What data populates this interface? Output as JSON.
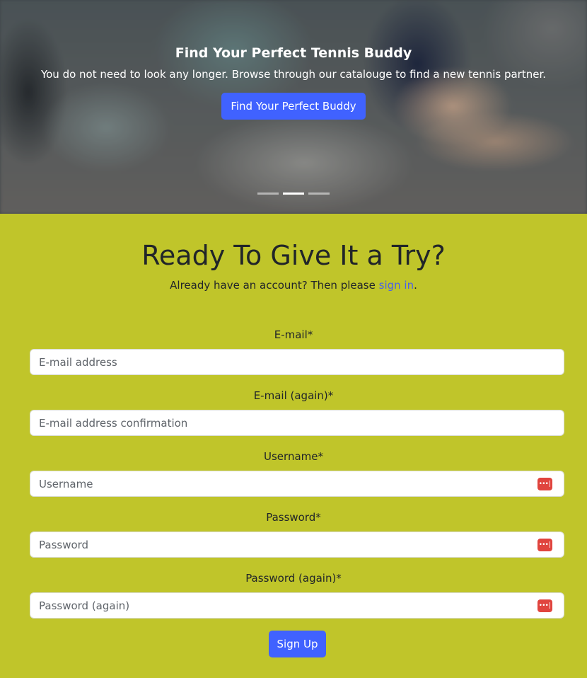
{
  "hero": {
    "title": "Find Your Perfect Tennis Buddy",
    "text": "You do not need to look any longer. Browse through our catalouge to find a new tennis partner.",
    "button_label": "Find Your Perfect Buddy",
    "active_slide": 2,
    "slide_count": 3
  },
  "signup": {
    "title": "Ready To Give It a Try?",
    "subtitle_prefix": "Already have an account? Then please ",
    "signin_link": "sign in",
    "subtitle_suffix": ".",
    "fields": [
      {
        "label": "E-mail*",
        "placeholder": "E-mail address"
      },
      {
        "label": "E-mail (again)*",
        "placeholder": "E-mail address confirmation"
      },
      {
        "label": "Username*",
        "placeholder": "Username"
      },
      {
        "label": "Password*",
        "placeholder": "Password"
      },
      {
        "label": "Password (again)*",
        "placeholder": "Password (again)"
      }
    ],
    "password_manager_icon": "password-manager-icon",
    "submit_label": "Sign Up"
  },
  "colors": {
    "accent": "#4062ff",
    "section_background": "#c0c52a",
    "link": "#4a62e8",
    "password_manager": "#e0443e"
  }
}
